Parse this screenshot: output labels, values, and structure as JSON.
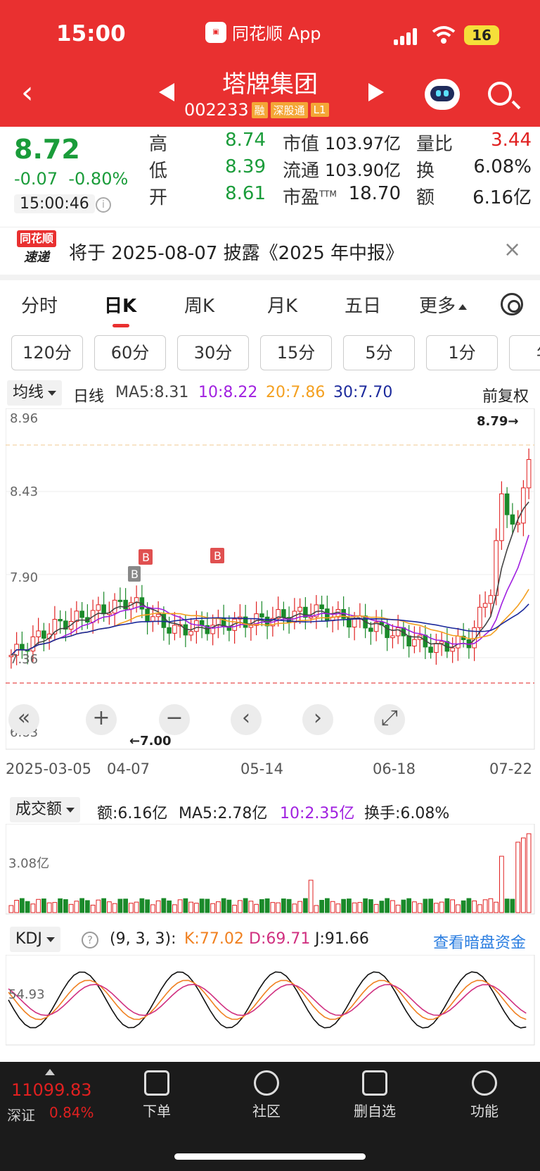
{
  "status": {
    "time": "15:00",
    "app_name": "同花顺 App",
    "battery": "16"
  },
  "header": {
    "stock_name": "塔牌集团",
    "stock_code": "002233",
    "tags": [
      "融",
      "深股通",
      "L1"
    ]
  },
  "quote": {
    "price": "8.72",
    "change": "-0.07",
    "change_pct": "-0.80%",
    "time": "15:00:46",
    "high_label": "高",
    "high": "8.74",
    "low_label": "低",
    "low": "8.39",
    "open_label": "开",
    "open": "8.61",
    "mcap_label": "市值",
    "mcap": "103.97亿",
    "float_label": "流通",
    "float": "103.90亿",
    "pe_label": "市盈",
    "pe_sup": "TTM",
    "pe": "18.70",
    "vr_label": "量比",
    "vr": "3.44",
    "turnover_label": "换",
    "turnover": "6.08%",
    "amount_label": "额",
    "amount": "6.16亿"
  },
  "news": {
    "logo_top": "同花顺",
    "logo_bottom": "速递",
    "text": "将于 2025-08-07 披露《2025 年中报》"
  },
  "period_tabs": [
    "分时",
    "日K",
    "周K",
    "月K",
    "五日",
    "更多"
  ],
  "minute_tabs": [
    "120分",
    "60分",
    "30分",
    "15分",
    "5分",
    "1分",
    "年"
  ],
  "ma_legend": {
    "select": "均线",
    "line_type": "日线",
    "ma5": "MA5:8.31",
    "ma10": "10:8.22",
    "ma20": "20:7.86",
    "ma30": "30:7.70",
    "adjust": "前复权",
    "colors": {
      "ma5": "#444444",
      "ma10": "#a020e0",
      "ma20": "#f4a020",
      "ma30": "#1c2a9c"
    }
  },
  "chart_labels": {
    "y_ticks": [
      "8.96",
      "8.43",
      "7.90",
      "7.36",
      "6.83"
    ],
    "max_marker": "8.79→",
    "min_marker": "←7.00",
    "buy_marker": "B",
    "dates": [
      "2025-03-05",
      "04-07",
      "05-14",
      "06-18",
      "07-22"
    ]
  },
  "chart_data": {
    "type": "candlestick",
    "x_range": [
      "2025-03-05",
      "2025-07-22"
    ],
    "ylim": [
      6.83,
      8.96
    ],
    "annotations": {
      "max": 8.79,
      "min": 7.0,
      "last_close": 8.72
    }
  },
  "volume": {
    "select": "成交额",
    "amount": "额:6.16亿",
    "ma5": "MA5:2.78亿",
    "ma10": "10:2.35亿",
    "turnover": "换手:6.08%",
    "y_tick": "3.08亿"
  },
  "kdj": {
    "select": "KDJ",
    "params": "(9, 3, 3):",
    "k": "K:77.02",
    "d": "D:69.71",
    "j": "J:91.66",
    "link": "查看暗盘资金",
    "y_tick": "54.93"
  },
  "bottom": {
    "index_value": "11099.83",
    "index_name": "深证",
    "index_pct": "0.84%",
    "nav": [
      "下单",
      "社区",
      "删自选",
      "功能"
    ]
  }
}
